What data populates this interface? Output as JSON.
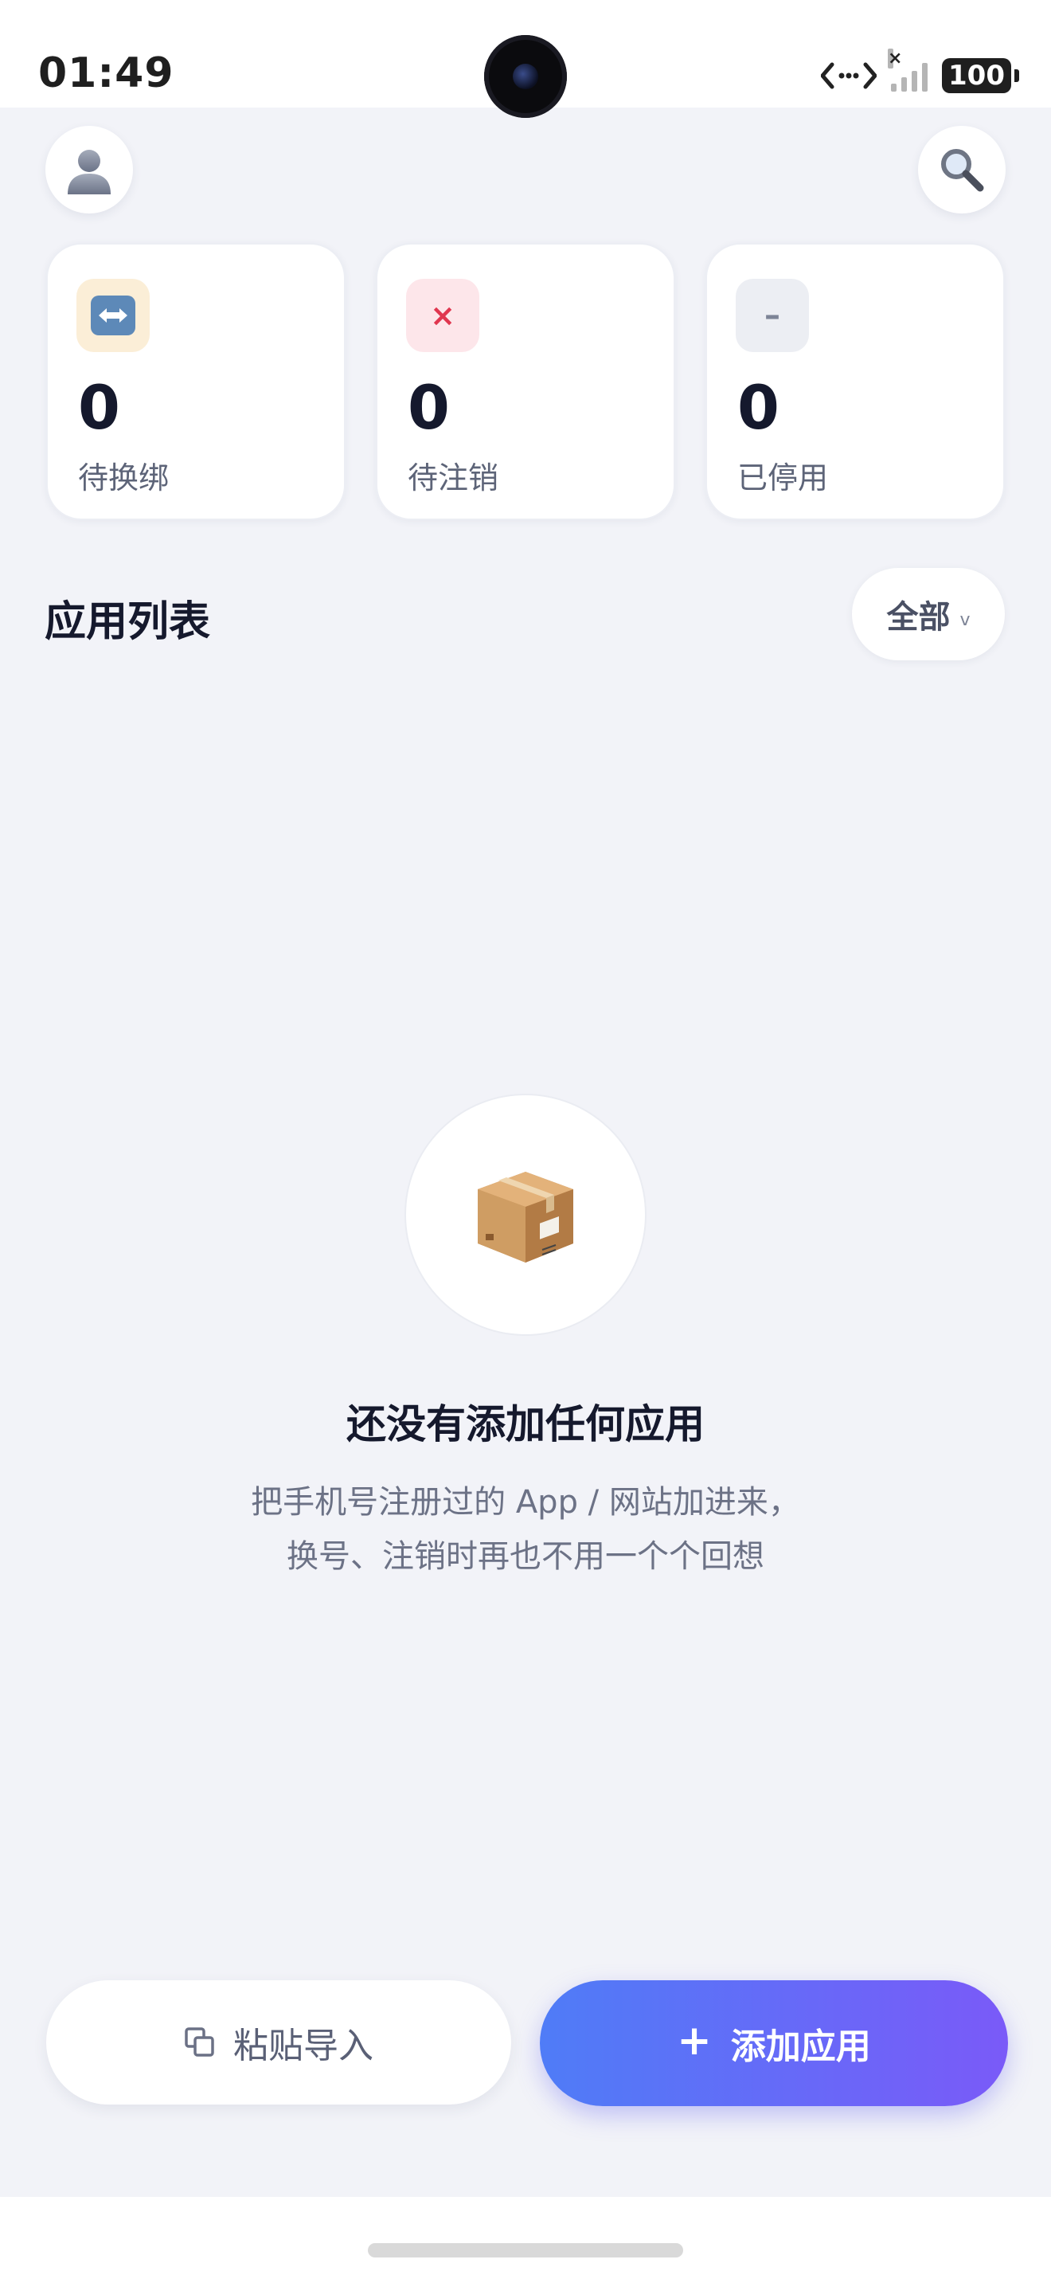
{
  "status_bar": {
    "time": "01:49",
    "battery": "100",
    "icons": [
      "network-transfer-icon",
      "signal-icon",
      "battery-icon"
    ]
  },
  "header": {
    "avatar_icon": "user-avatar-icon",
    "search_icon": "search-icon"
  },
  "stats": [
    {
      "icon": "swap-icon",
      "value": "0",
      "label": "待换绑",
      "color": "#fbeed7"
    },
    {
      "icon": "close-icon",
      "value": "0",
      "label": "待注销",
      "color": "#fde6ea"
    },
    {
      "icon": "minus-icon",
      "value": "0",
      "label": "已停用",
      "color": "#eceef3"
    }
  ],
  "app_list": {
    "title": "应用列表",
    "filter": {
      "selected": "全部"
    }
  },
  "empty_state": {
    "icon": "package-box-icon",
    "title": "还没有添加任何应用",
    "desc_line1": "把手机号注册过的 App / 网站加进来，",
    "desc_line2": "换号、注销时再也不用一个个回想"
  },
  "actions": {
    "paste_import": "粘贴导入",
    "add_app": "添加应用"
  },
  "colors": {
    "background": "#f2f3f8",
    "accent_start": "#4f7cf7",
    "accent_end": "#7a5af8",
    "danger": "#e0364f"
  }
}
